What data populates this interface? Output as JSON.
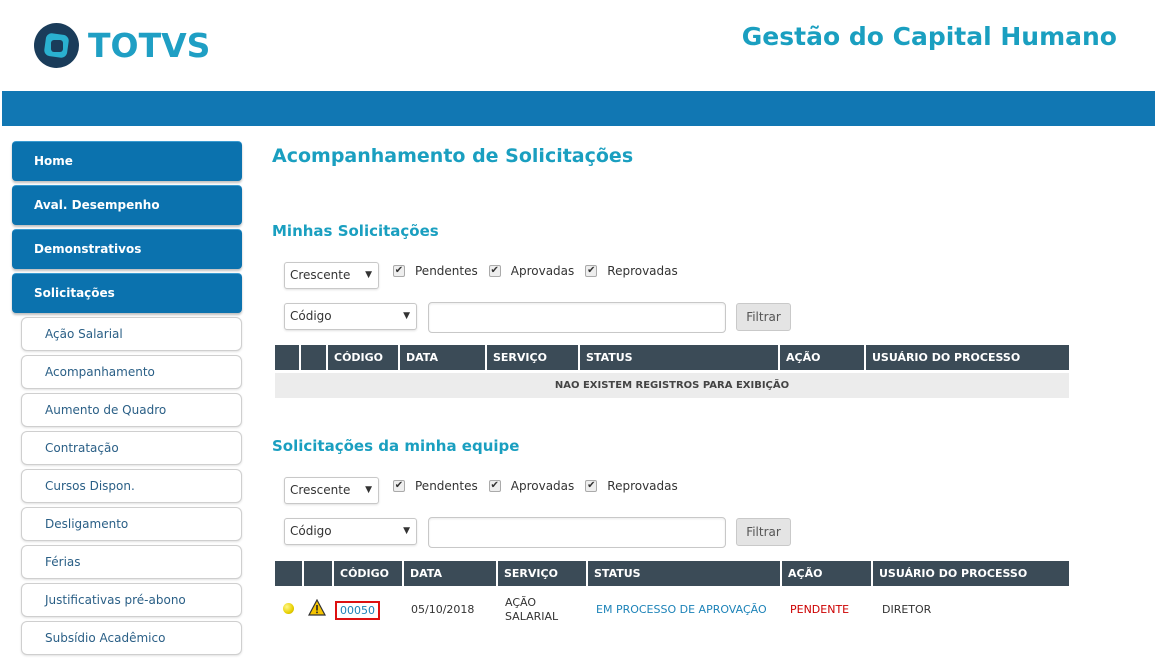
{
  "brand": {
    "logo_text": "TOTVS",
    "app_title": "Gestão do Capital Humano"
  },
  "colors": {
    "accent": "#1a9fc0",
    "topbar": "#1177b3",
    "nav": "#0b72ae",
    "table_header": "#3b4b57",
    "pending": "#cc0000"
  },
  "sidebar": {
    "main_items": [
      {
        "label": "Home"
      },
      {
        "label": "Aval. Desempenho"
      },
      {
        "label": "Demonstrativos"
      },
      {
        "label": "Solicitações"
      }
    ],
    "sub_items": [
      {
        "label": "Ação Salarial"
      },
      {
        "label": "Acompanhamento"
      },
      {
        "label": "Aumento de Quadro"
      },
      {
        "label": "Contratação"
      },
      {
        "label": "Cursos Dispon."
      },
      {
        "label": "Desligamento"
      },
      {
        "label": "Férias"
      },
      {
        "label": "Justificativas pré-abono"
      },
      {
        "label": "Subsídio Acadêmico"
      }
    ]
  },
  "page": {
    "title": "Acompanhamento de Solicitações"
  },
  "my_requests": {
    "title": "Minhas Solicitações",
    "order_value": "Crescente",
    "filters": {
      "pending": "Pendentes",
      "approved": "Aprovadas",
      "rejected": "Reprovadas"
    },
    "field_value": "Código",
    "search_value": "",
    "filter_button": "Filtrar",
    "columns": [
      "CÓDIGO",
      "DATA",
      "SERVIÇO",
      "STATUS",
      "AÇÃO",
      "USUÁRIO DO PROCESSO"
    ],
    "empty_message": "NAO EXISTEM REGISTROS PARA EXIBIÇÃO"
  },
  "team_requests": {
    "title": "Solicitações da minha equipe",
    "order_value": "Crescente",
    "filters": {
      "pending": "Pendentes",
      "approved": "Aprovadas",
      "rejected": "Reprovadas"
    },
    "field_value": "Código",
    "search_value": "",
    "filter_button": "Filtrar",
    "columns": [
      "CÓDIGO",
      "DATA",
      "SERVIÇO",
      "STATUS",
      "AÇÃO",
      "USUÁRIO DO PROCESSO"
    ],
    "rows": [
      {
        "status_icon": "yellow-dot-icon",
        "alert_icon": "warning-icon",
        "code": "00050",
        "date": "05/10/2018",
        "service_line1": "AÇÃO",
        "service_line2": "SALARIAL",
        "status": "EM PROCESSO DE APROVAÇÃO",
        "action": "PENDENTE",
        "user": "DIRETOR"
      }
    ]
  }
}
